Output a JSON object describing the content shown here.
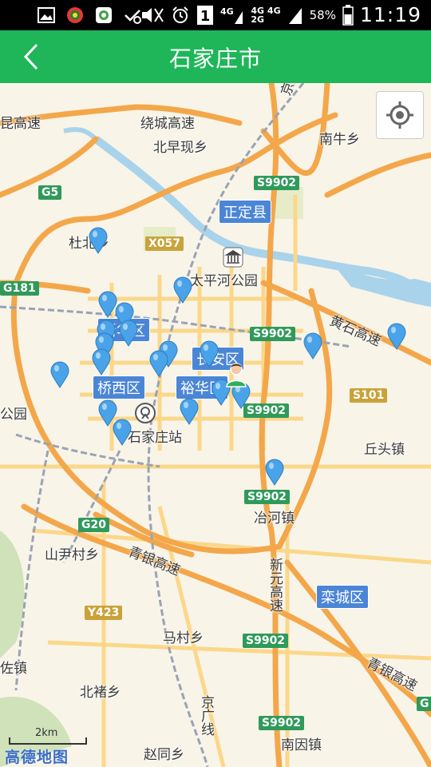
{
  "status_bar": {
    "network_top": "4G 4G",
    "network_bottom": "2G",
    "battery": "58%",
    "time": "11:19"
  },
  "app_bar": {
    "title": "石家庄市",
    "back_icon": "chevron-left-icon"
  },
  "map": {
    "places": [
      {
        "id": "beizaoxian",
        "label": "北早现乡"
      },
      {
        "id": "nanniuxiang",
        "label": "南牛乡"
      },
      {
        "id": "dubeixiang",
        "label": "杜北乡"
      },
      {
        "id": "taipinghe",
        "label": "太平河公园"
      },
      {
        "id": "qiutouzhen",
        "label": "丘头镇"
      },
      {
        "id": "sjz-station",
        "label": "石家庄站"
      },
      {
        "id": "yehezhen",
        "label": "冶河镇"
      },
      {
        "id": "shanyincun",
        "label": "山尹村乡"
      },
      {
        "id": "macunxiang",
        "label": "马村乡"
      },
      {
        "id": "zuozhen",
        "label": "佐镇"
      },
      {
        "id": "beichuxiang",
        "label": "北褚乡"
      },
      {
        "id": "zhaotongxiang",
        "label": "赵同乡"
      },
      {
        "id": "nanyinzhen",
        "label": "南因镇"
      },
      {
        "id": "gongyuan",
        "label": "公园"
      }
    ],
    "districts": [
      {
        "id": "zhengding",
        "label": "正定县"
      },
      {
        "id": "xinhua",
        "label": "新华区"
      },
      {
        "id": "changan",
        "label": "长安区"
      },
      {
        "id": "qiaoxi",
        "label": "桥西区"
      },
      {
        "id": "yuhua",
        "label": "裕华区"
      },
      {
        "id": "luancheng",
        "label": "栾城区"
      }
    ],
    "road_labels": [
      {
        "id": "raocheng",
        "label": "绕城高速"
      },
      {
        "id": "gaosu-left",
        "label": "昆高速"
      },
      {
        "id": "jingguang-top",
        "label": "京广线"
      },
      {
        "id": "huangshi",
        "label": "黄石高速"
      },
      {
        "id": "qingyin-left",
        "label": "青银高速"
      },
      {
        "id": "qingyin-right",
        "label": "青银高速"
      },
      {
        "id": "xinyuan",
        "label": "新元高速"
      },
      {
        "id": "jingguang-bottom",
        "label": "京广线"
      }
    ],
    "shields": [
      {
        "id": "g5",
        "label": "G5"
      },
      {
        "id": "s9902-a",
        "label": "S9902"
      },
      {
        "id": "x057",
        "label": "X057"
      },
      {
        "id": "g181",
        "label": "G181"
      },
      {
        "id": "s9902-b",
        "label": "S9902"
      },
      {
        "id": "s101",
        "label": "S101"
      },
      {
        "id": "s9902-c",
        "label": "S9902"
      },
      {
        "id": "s9902-d",
        "label": "S9902"
      },
      {
        "id": "g20",
        "label": "G20"
      },
      {
        "id": "y423",
        "label": "Y423"
      },
      {
        "id": "s9902-e",
        "label": "S9902"
      },
      {
        "id": "s9902-f",
        "label": "S9902"
      },
      {
        "id": "g-right",
        "label": "G"
      }
    ],
    "scale": "2km",
    "logo": "高德地图",
    "locate_icon": "crosshair-icon",
    "colors": {
      "water": "#a9d3ea",
      "highway": "#f3a74a",
      "road": "#fbd78a",
      "district": "#4b86d6",
      "pin": "#4aa3e8"
    }
  }
}
